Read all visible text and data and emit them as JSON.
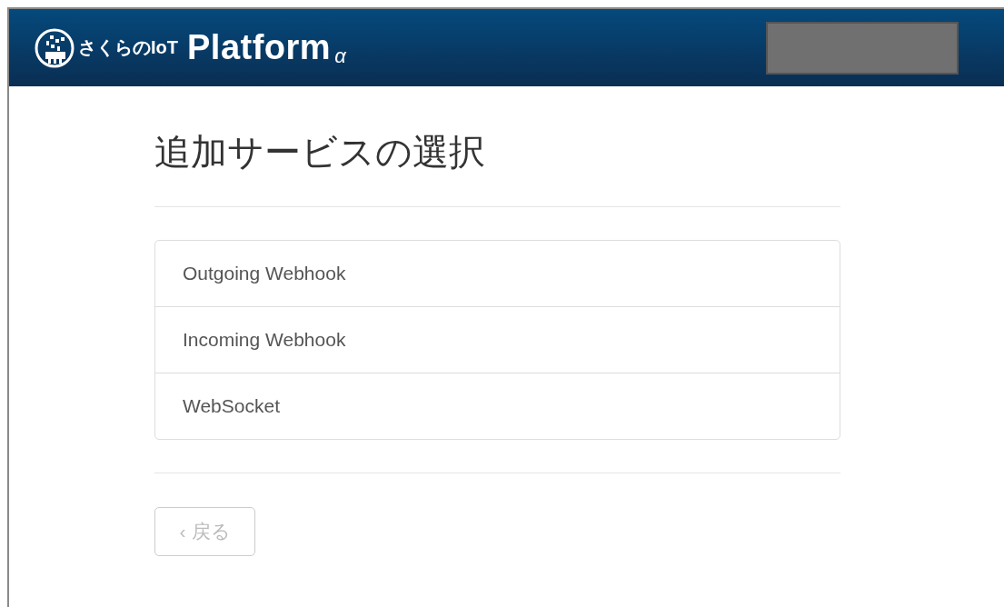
{
  "header": {
    "logo": {
      "brand": "さくらのIoT",
      "product": "Platform",
      "suffix": "α"
    },
    "account": {
      "kind": "redacted"
    }
  },
  "title": "追加サービスの選択",
  "services": [
    {
      "label": "Outgoing Webhook"
    },
    {
      "label": "Incoming Webhook"
    },
    {
      "label": "WebSocket"
    }
  ],
  "back_button": {
    "chevron": "‹",
    "label": "戻る",
    "disabled": true
  }
}
